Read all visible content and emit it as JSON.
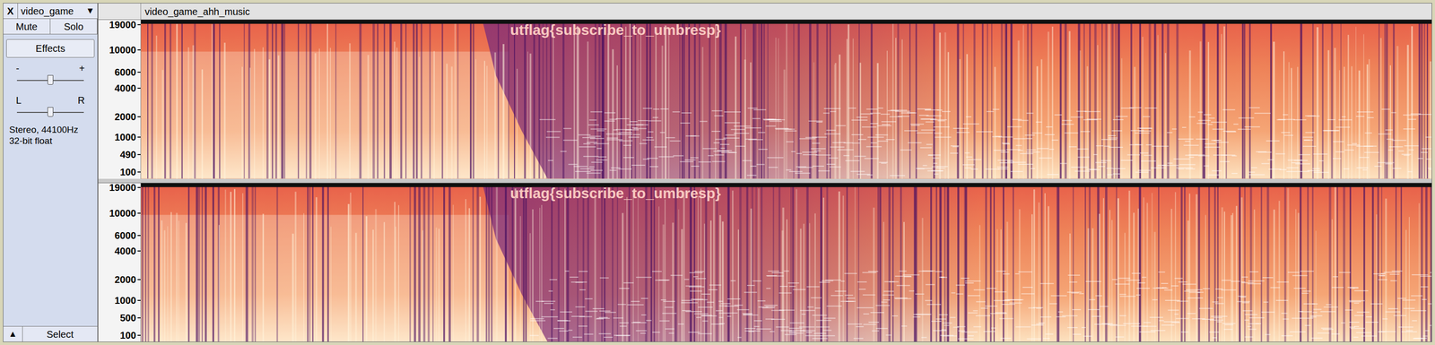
{
  "track": {
    "close": "X",
    "name": "video_game",
    "menu_arrow": "▼",
    "title": "video_game_ahh_music"
  },
  "buttons": [
    {
      "label": "Mute",
      "selected": false
    },
    {
      "label": "Solo",
      "selected": false
    }
  ],
  "effects_button": "Effects",
  "sliders": [
    {
      "min_label": "-",
      "max_label": "+",
      "level": 0.5
    },
    {
      "min_label": "L",
      "max_label": "R",
      "level": 0.5
    }
  ],
  "info": [
    "Stereo, 44100Hz",
    "32-bit float"
  ],
  "collapse": "▲",
  "select": "Select",
  "channels": [
    {
      "ticks": [
        "19000",
        "10000",
        "6000",
        "4000",
        "2000",
        "1000",
        "490",
        "100"
      ]
    },
    {
      "ticks": [
        "19000",
        "10000",
        "6000",
        "4000",
        "2000",
        "1000",
        "500",
        "100"
      ]
    }
  ],
  "spectrogram": {
    "overlay_text": "utflag{subscribe_to_umbresp}"
  }
}
